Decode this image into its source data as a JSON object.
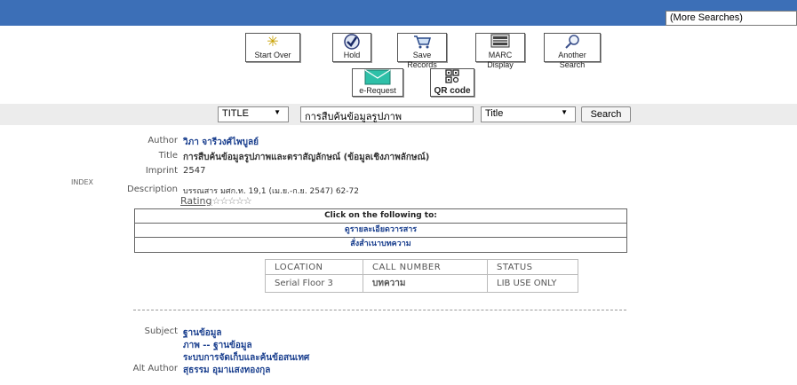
{
  "header": {
    "more_searches": "(More Searches)"
  },
  "toolbar": {
    "start_over": "Start Over",
    "hold": "Hold",
    "save_records": "Save Records",
    "marc_display": "MARC Display",
    "another_search": "Another Search",
    "e_request": "e-Request",
    "qr_code": "QR code"
  },
  "search": {
    "field": "TITLE",
    "term": "การสืบค้นข้อมูลรูปภาพ",
    "sort": "Title",
    "button": "Search"
  },
  "index_label": "INDEX",
  "record": {
    "author_label": "Author",
    "author": "วิภา จารีวงศ์ไพบูลย์",
    "title_label": "Title",
    "title": "การสืบค้นข้อมูลรูปภาพและตราสัญลักษณ์ (ข้อมูลเชิงภาพลักษณ์)",
    "imprint_label": "Imprint",
    "imprint": "2547",
    "description_label": "Description",
    "description": "บรรณสาร มศก.ท. 19,1 (เม.ย.-ก.ย. 2547) 62-72",
    "rating_label": "Rating",
    "stars": "☆☆☆☆☆"
  },
  "click_box": {
    "header": "Click on the following to:",
    "link1": "ดูรายละเอียดวารสาร",
    "link2": "สั่งสำเนาบทความ"
  },
  "items": {
    "headers": [
      "LOCATION",
      "CALL NUMBER",
      "STATUS"
    ],
    "row": [
      "Serial Floor 3",
      "บทความ",
      "LIB USE ONLY"
    ]
  },
  "subjects": {
    "subject_label": "Subject",
    "s1": "ฐานข้อมูล",
    "s2": "ภาพ -- ฐานข้อมูล",
    "s3": "ระบบการจัดเก็บและค้นข้อสนเทศ",
    "alt_author_label": "Alt Author",
    "alt_author": "สุธรรม อุมาแสงทองกุล"
  }
}
